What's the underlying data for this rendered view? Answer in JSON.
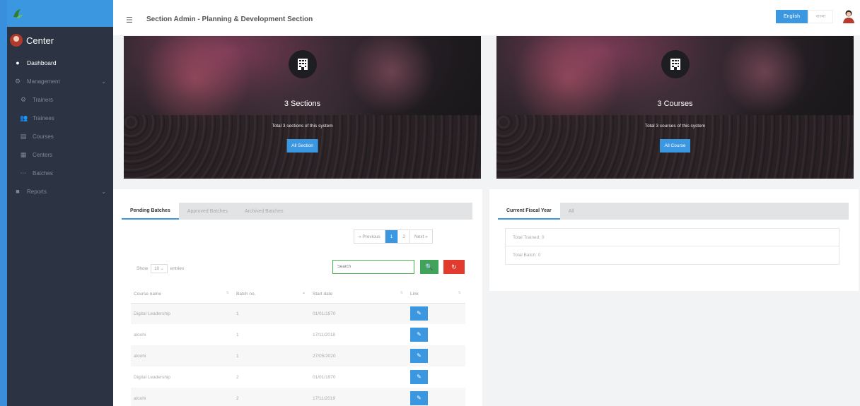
{
  "header": {
    "title": "Section Admin - Planning & Development Section",
    "lang_english": "English",
    "lang_bangla": "বাংলা"
  },
  "sidebar": {
    "user_name": "Center",
    "items": [
      {
        "label": "Dashboard",
        "icon": "dashboard-icon"
      },
      {
        "label": "Management",
        "icon": "gear-icon"
      },
      {
        "label": "Trainers",
        "icon": "gear-icon"
      },
      {
        "label": "Trainees",
        "icon": "users-icon"
      },
      {
        "label": "Courses",
        "icon": "book-icon"
      },
      {
        "label": "Centers",
        "icon": "building-icon"
      },
      {
        "label": "Batches",
        "icon": "dots-icon"
      },
      {
        "label": "Reports",
        "icon": "chart-icon"
      }
    ]
  },
  "banners": [
    {
      "count_text": "3 Sections",
      "subtitle": "Total 3 sections of this system",
      "button": "All Section"
    },
    {
      "count_text": "3 Courses",
      "subtitle": "Total 3 courses of this system",
      "button": "All Course"
    }
  ],
  "batches": {
    "tabs": [
      "Pending Batches",
      "Approved Batches",
      "Archived Batches"
    ],
    "pagination": {
      "prev": "« Previous",
      "pages": [
        "1",
        "2"
      ],
      "next": "Next »"
    },
    "show_label": "Show",
    "entries_value": "10",
    "entries_label": "entries",
    "search_placeholder": "Search",
    "columns": [
      "Course name",
      "Batch no.",
      "Start date",
      "Link"
    ],
    "rows": [
      {
        "course": "Digital Leadership",
        "batch": "1",
        "date": "01/01/1970"
      },
      {
        "course": "aloohi",
        "batch": "1",
        "date": "17/11/2018"
      },
      {
        "course": "aloohi",
        "batch": "1",
        "date": "27/05/2020"
      },
      {
        "course": "Digital Leadership",
        "batch": "2",
        "date": "01/01/1970"
      },
      {
        "course": "aloohi",
        "batch": "2",
        "date": "17/11/2019"
      }
    ]
  },
  "fiscal": {
    "tabs": [
      "Current Fiscal Year",
      "All"
    ],
    "items": [
      "Total Trained: 0",
      "Total Batch: 0"
    ]
  },
  "colors": {
    "accent": "#3b98e0",
    "sidebar": "#2c3443",
    "success": "#3fa35a",
    "danger": "#e23b2e"
  }
}
